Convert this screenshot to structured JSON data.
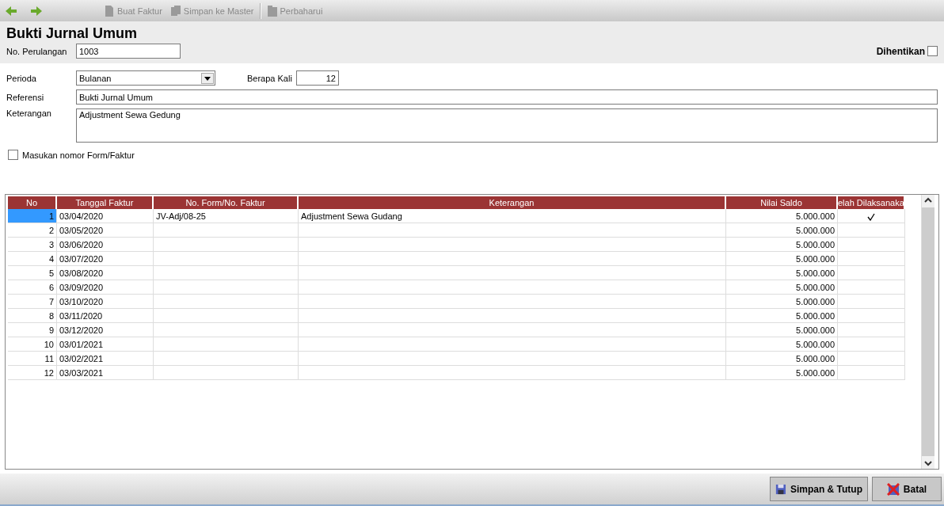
{
  "toolbar": {
    "items": [
      {
        "label": "Buat Faktur",
        "kind": "doc"
      },
      {
        "label": "Simpan ke Master",
        "kind": "stack"
      },
      {
        "label": "Perbaharui",
        "kind": "refresh"
      }
    ]
  },
  "title": "Bukti Jurnal Umum",
  "loop_number": {
    "label": "No. Perulangan",
    "value": "1003"
  },
  "stopped": {
    "label": "Dihentikan",
    "checked": false
  },
  "period": {
    "label": "Perioda",
    "value": "Bulanan"
  },
  "times": {
    "label": "Berapa Kali",
    "value": "12"
  },
  "reference": {
    "label": "Referensi",
    "value": "Bukti Jurnal Umum"
  },
  "description": {
    "label": "Keterangan",
    "value": "Adjustment Sewa Gedung"
  },
  "enter_form_number": {
    "label": "Masukan nomor Form/Faktur",
    "checked": false
  },
  "table": {
    "columns": [
      "No",
      "Tanggal Faktur",
      "No. Form/No. Faktur",
      "Keterangan",
      "Nilai Saldo",
      "elah Dilaksanaka"
    ],
    "rows": [
      {
        "no": "1",
        "date": "03/04/2020",
        "form": "JV-Adj/08-25",
        "note": "Adjustment Sewa Gudang",
        "amount": "5.000.000",
        "done": true,
        "selected": true
      },
      {
        "no": "2",
        "date": "03/05/2020",
        "form": "",
        "note": "",
        "amount": "5.000.000",
        "done": false,
        "selected": false
      },
      {
        "no": "3",
        "date": "03/06/2020",
        "form": "",
        "note": "",
        "amount": "5.000.000",
        "done": false,
        "selected": false
      },
      {
        "no": "4",
        "date": "03/07/2020",
        "form": "",
        "note": "",
        "amount": "5.000.000",
        "done": false,
        "selected": false
      },
      {
        "no": "5",
        "date": "03/08/2020",
        "form": "",
        "note": "",
        "amount": "5.000.000",
        "done": false,
        "selected": false
      },
      {
        "no": "6",
        "date": "03/09/2020",
        "form": "",
        "note": "",
        "amount": "5.000.000",
        "done": false,
        "selected": false
      },
      {
        "no": "7",
        "date": "03/10/2020",
        "form": "",
        "note": "",
        "amount": "5.000.000",
        "done": false,
        "selected": false
      },
      {
        "no": "8",
        "date": "03/11/2020",
        "form": "",
        "note": "",
        "amount": "5.000.000",
        "done": false,
        "selected": false
      },
      {
        "no": "9",
        "date": "03/12/2020",
        "form": "",
        "note": "",
        "amount": "5.000.000",
        "done": false,
        "selected": false
      },
      {
        "no": "10",
        "date": "03/01/2021",
        "form": "",
        "note": "",
        "amount": "5.000.000",
        "done": false,
        "selected": false
      },
      {
        "no": "11",
        "date": "03/02/2021",
        "form": "",
        "note": "",
        "amount": "5.000.000",
        "done": false,
        "selected": false
      },
      {
        "no": "12",
        "date": "03/03/2021",
        "form": "",
        "note": "",
        "amount": "5.000.000",
        "done": false,
        "selected": false
      }
    ]
  },
  "buttons": [
    {
      "label": "Simpan & Tutup",
      "kind": "save"
    },
    {
      "label": "Batal",
      "kind": "cancel"
    }
  ]
}
